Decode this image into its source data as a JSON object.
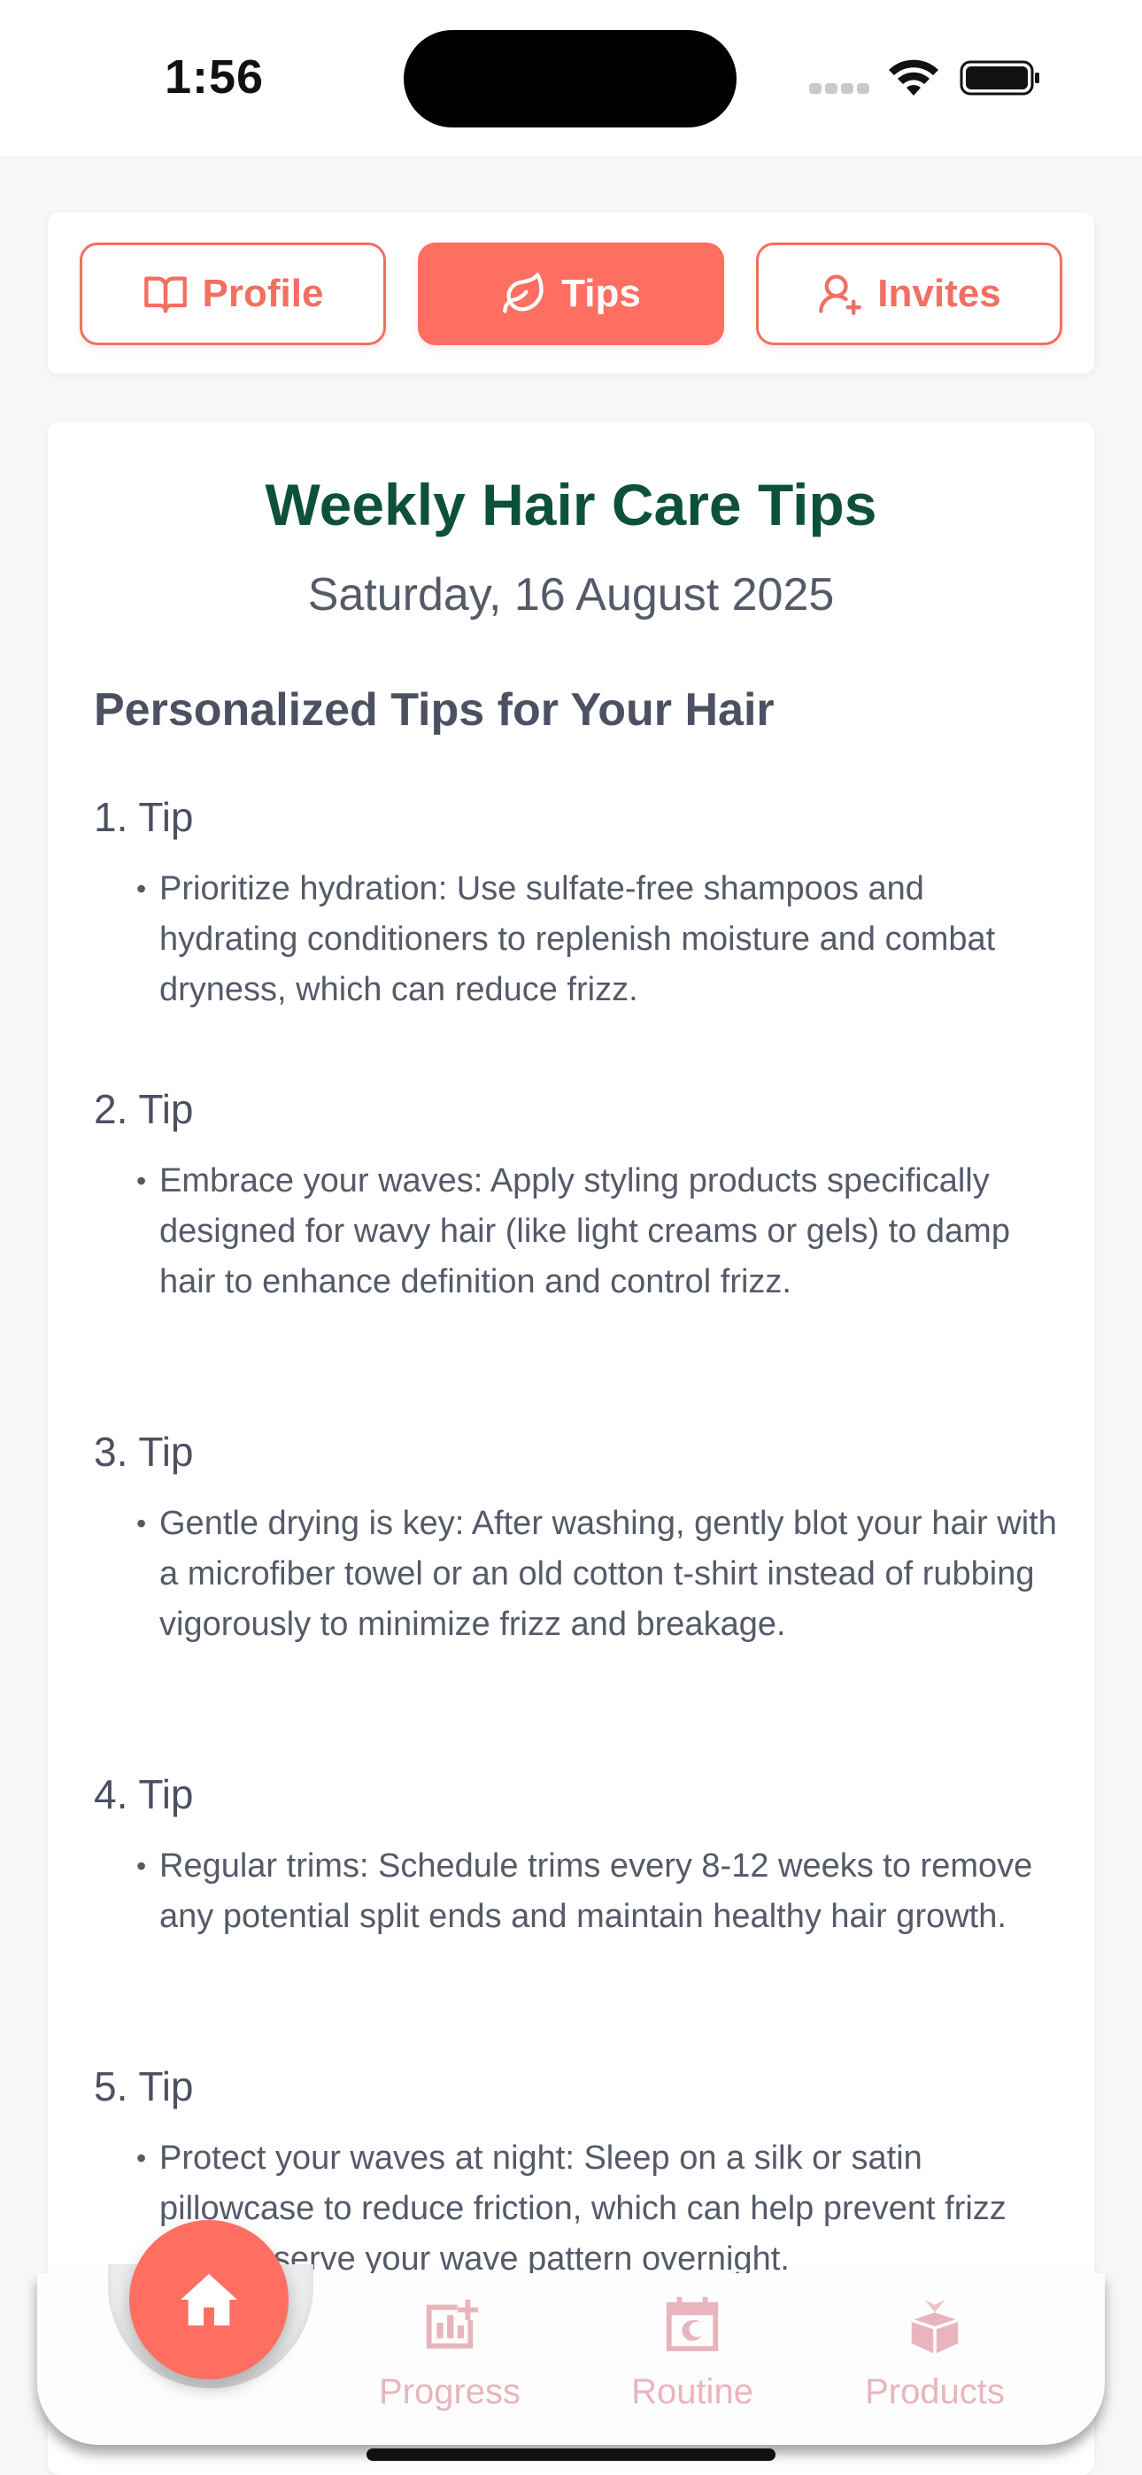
{
  "status_bar": {
    "time": "1:56"
  },
  "tabs": [
    {
      "label": "Profile",
      "icon": "book-open-icon",
      "active": false
    },
    {
      "label": "Tips",
      "icon": "leaf-icon",
      "active": true
    },
    {
      "label": "Invites",
      "icon": "user-plus-icon",
      "active": false
    }
  ],
  "card": {
    "title": "Weekly Hair Care Tips",
    "date": "Saturday, 16 August 2025",
    "section_title": "Personalized Tips for Your Hair",
    "tips": [
      {
        "heading": "1. Tip",
        "text": "Prioritize hydration: Use sulfate-free shampoos and hydrating conditioners to replenish moisture and combat dryness, which can reduce frizz."
      },
      {
        "heading": "2. Tip",
        "text": "Embrace your waves: Apply styling products specifically designed for wavy hair (like light creams or gels) to damp hair to enhance definition and control frizz."
      },
      {
        "heading": "3. Tip",
        "text": "Gentle drying is key: After washing, gently blot your hair with a microfiber towel or an old cotton t-shirt instead of rubbing vigorously to minimize frizz and breakage."
      },
      {
        "heading": "4. Tip",
        "text": "Regular trims: Schedule trims every 8-12 weeks to remove any potential split ends and maintain healthy hair growth."
      },
      {
        "heading": "5. Tip",
        "text": "Protect your waves at night: Sleep on a silk or satin pillowcase to reduce friction, which can help prevent frizz and preserve your wave pattern overnight."
      }
    ]
  },
  "bottom_nav": {
    "home_icon": "home-icon",
    "items": [
      {
        "label": "Progress",
        "icon": "chart-plus-icon"
      },
      {
        "label": "Routine",
        "icon": "calendar-icon"
      },
      {
        "label": "Products",
        "icon": "gift-box-icon"
      }
    ]
  },
  "colors": {
    "accent": "#fe6e61",
    "title_green": "#0d5238",
    "nav_inactive": "#e8b5bd"
  }
}
